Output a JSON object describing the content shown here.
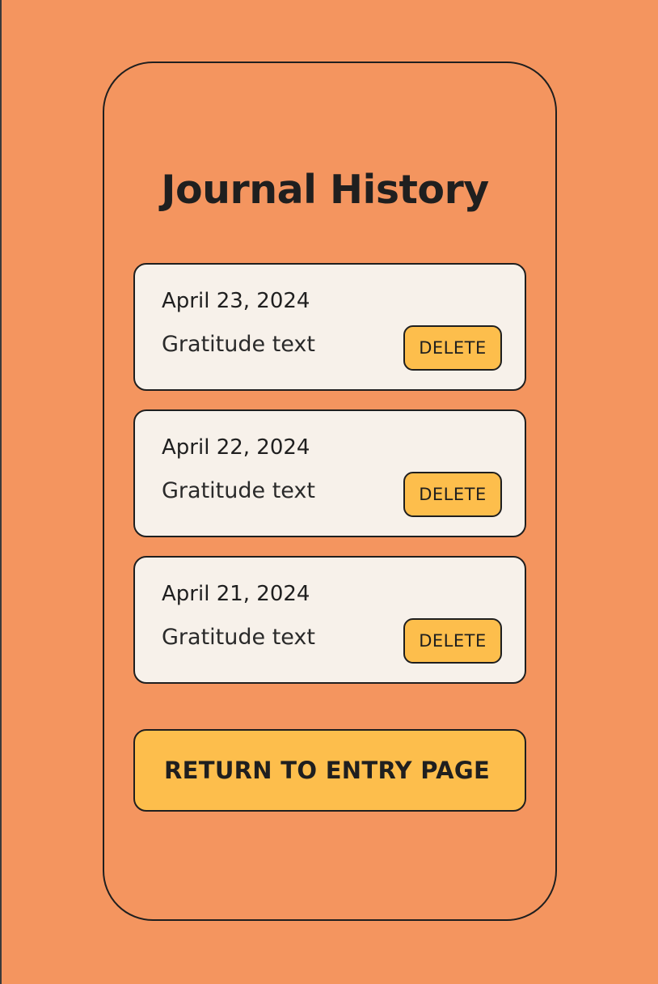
{
  "page": {
    "title": "Journal History",
    "background_color": "#F4955F",
    "card_color": "#F7F1EA",
    "accent_color": "#FDBE4C"
  },
  "entries": [
    {
      "date": "April 23, 2024",
      "text": "Gratitude text",
      "delete_label": "DELETE"
    },
    {
      "date": "April 22, 2024",
      "text": "Gratitude text",
      "delete_label": "DELETE"
    },
    {
      "date": "April 21, 2024",
      "text": "Gratitude text",
      "delete_label": "DELETE"
    }
  ],
  "footer": {
    "return_label": "RETURN TO ENTRY PAGE"
  }
}
